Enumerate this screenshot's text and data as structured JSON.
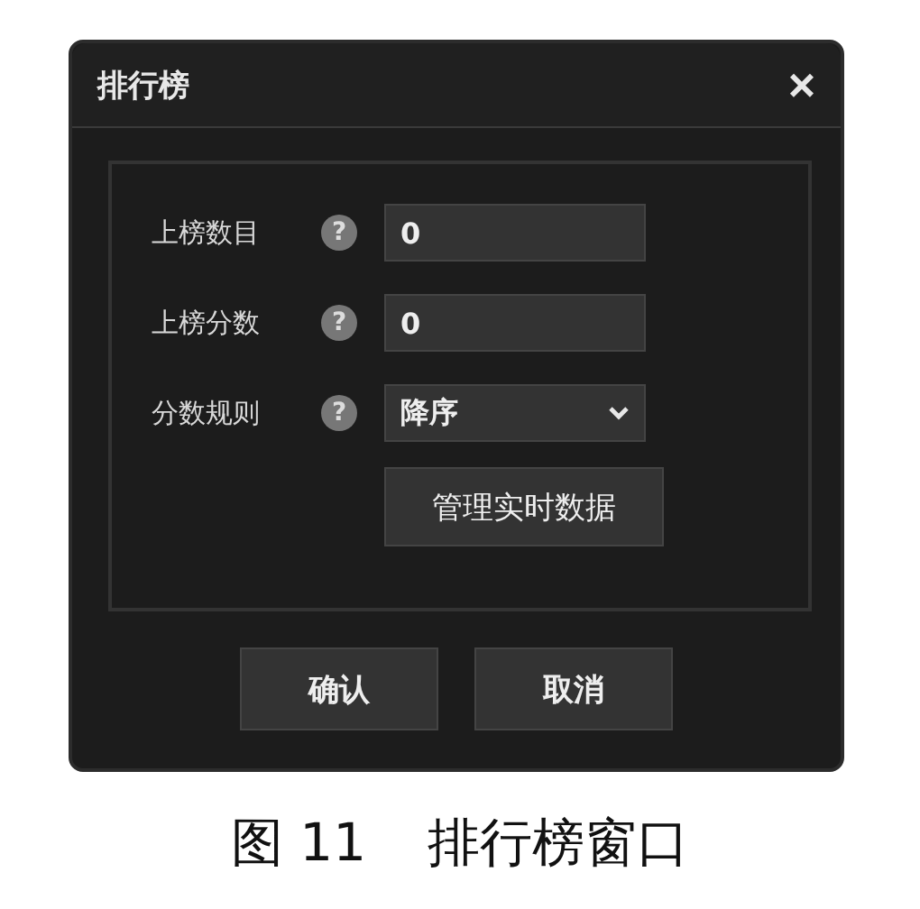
{
  "window": {
    "title": "排行榜",
    "close": "×"
  },
  "fields": [
    {
      "kind": "input",
      "label": "上榜数目",
      "help": "?",
      "value": "0"
    },
    {
      "kind": "input",
      "label": "上榜分数",
      "help": "?",
      "value": "0"
    },
    {
      "kind": "select",
      "label": "分数规则",
      "help": "?",
      "value": "降序"
    }
  ],
  "manage_button": "管理实时数据",
  "buttons": [
    "确认",
    "取消"
  ],
  "caption": {
    "number": "图 11",
    "text": "排行榜窗口"
  }
}
